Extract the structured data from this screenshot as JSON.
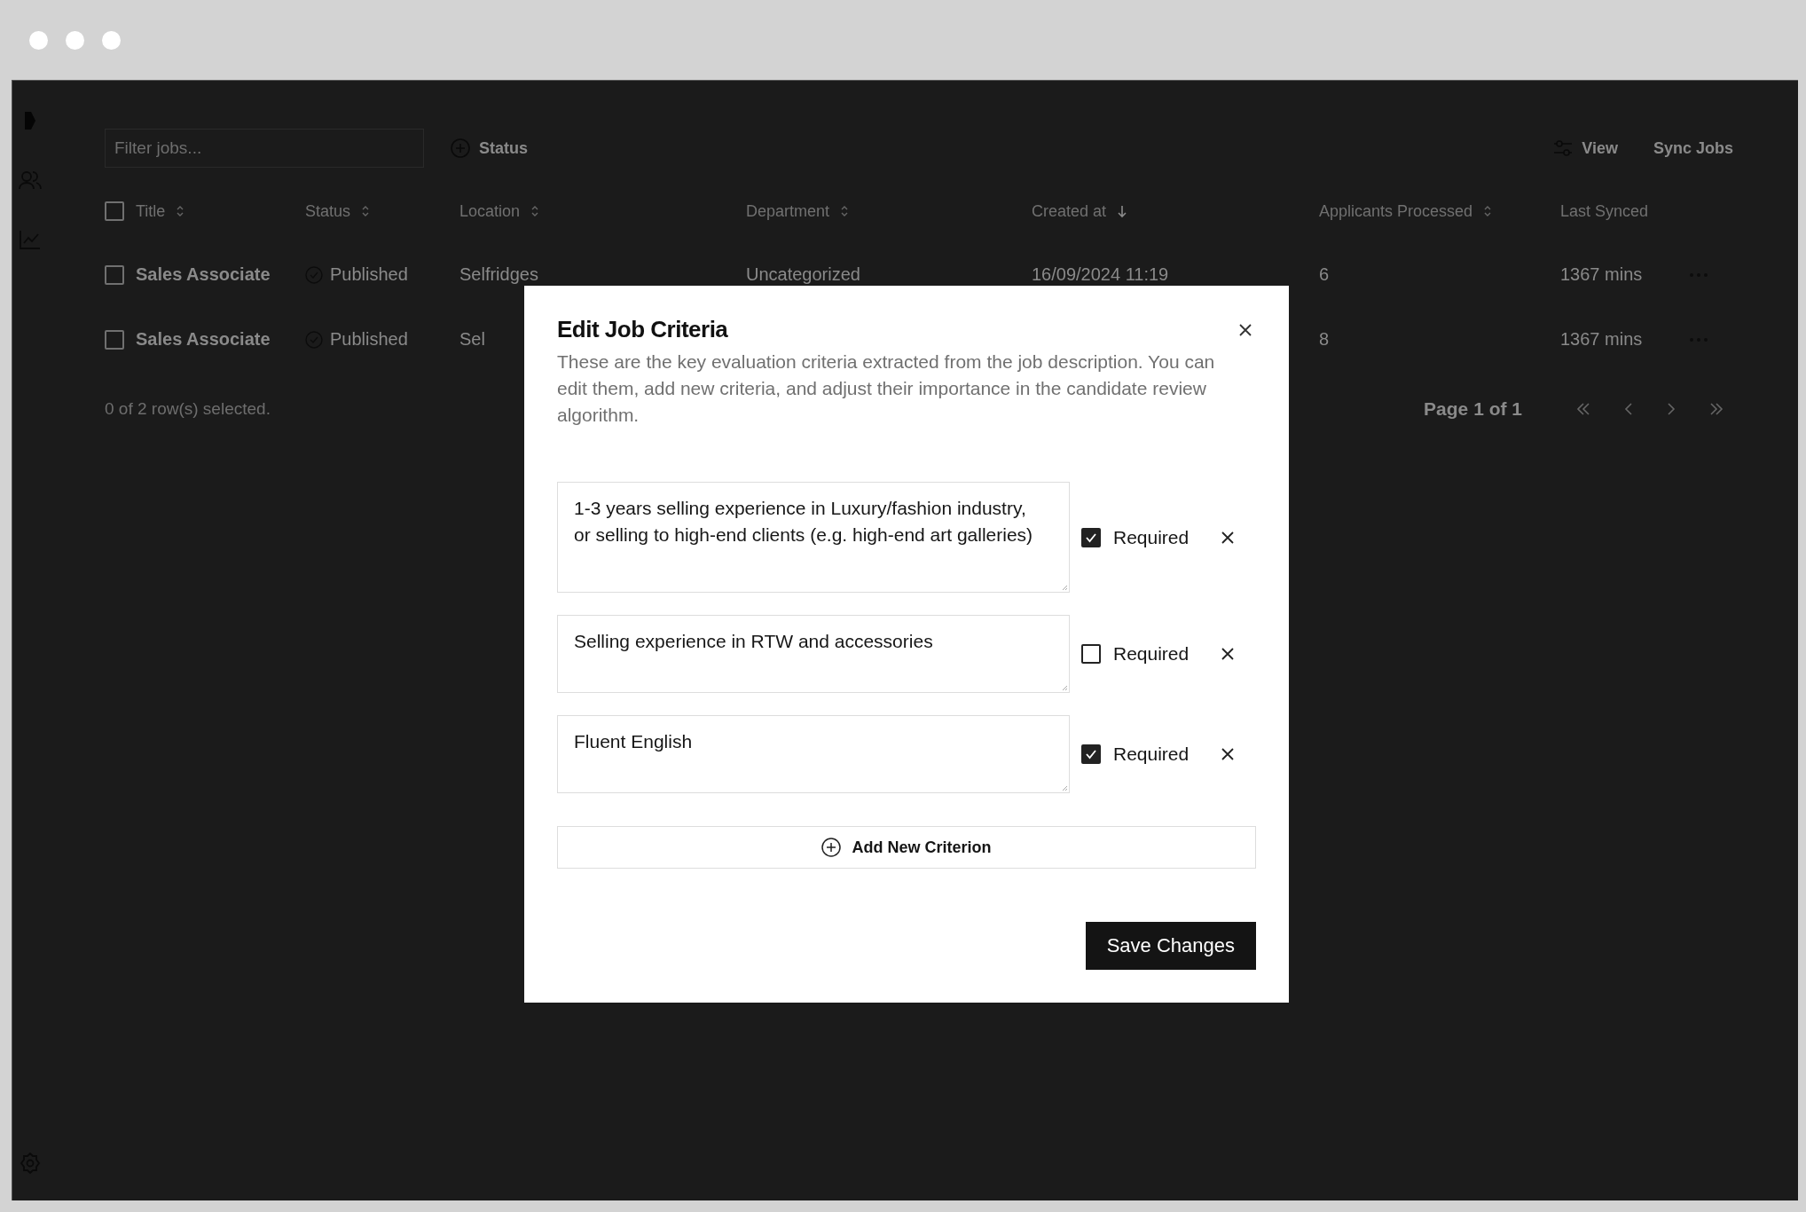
{
  "toolbar": {
    "filter_placeholder": "Filter jobs...",
    "status_filter": "Status",
    "view_button": "View",
    "sync_button": "Sync Jobs"
  },
  "table": {
    "all_selected": false,
    "columns": [
      {
        "label": "Title",
        "sortable": true,
        "sorted": false
      },
      {
        "label": "Status",
        "sortable": true,
        "sorted": false
      },
      {
        "label": "Location",
        "sortable": true,
        "sorted": false
      },
      {
        "label": "Department",
        "sortable": true,
        "sorted": false
      },
      {
        "label": "Created at",
        "sortable": true,
        "sorted": true
      },
      {
        "label": "Applicants Processed",
        "sortable": true,
        "sorted": false
      },
      {
        "label": "Last Synced",
        "sortable": false
      }
    ],
    "rows": [
      {
        "selected": false,
        "title": "Sales Associate",
        "status": "Published",
        "location": "Selfridges",
        "department": "Uncategorized",
        "created_at": "16/09/2024 11:19",
        "applicants": "6",
        "last_synced": "1367 mins"
      },
      {
        "selected": false,
        "title": "Sales Associate",
        "status": "Published",
        "location": "Sel",
        "applicants": "8",
        "last_synced": "1367 mins"
      }
    ]
  },
  "footer": {
    "selection_text": "0 of 2 row(s) selected.",
    "page_label": "Page 1 of 1"
  },
  "dialog": {
    "title": "Edit Job Criteria",
    "description": "These are the key evaluation criteria extracted from the job description. You can edit them, add new criteria, and adjust their importance in the candidate review algorithm.",
    "criteria": [
      {
        "text": "1-3 years selling experience in Luxury/fashion industry, or selling to high-end clients (e.g. high-end art galleries)",
        "required": true,
        "label": "Required"
      },
      {
        "text": "Selling experience in RTW and accessories",
        "required": false,
        "label": "Required"
      },
      {
        "text": "Fluent English",
        "required": true,
        "label": "Required"
      }
    ],
    "add_button": "Add New Criterion",
    "save_button": "Save Changes"
  }
}
